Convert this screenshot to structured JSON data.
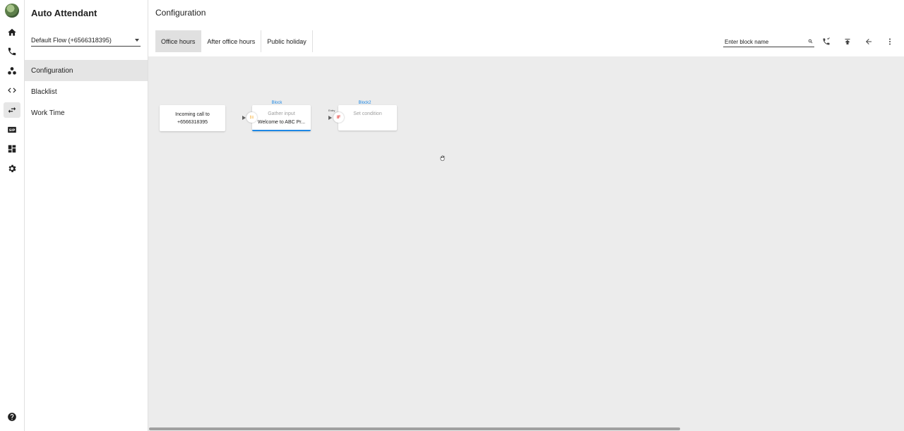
{
  "sidebar": {
    "title": "Auto Attendant",
    "flow": "Default Flow (+6566318395)",
    "items": [
      {
        "label": "Configuration"
      },
      {
        "label": "Blacklist"
      },
      {
        "label": "Work Time"
      }
    ]
  },
  "header": {
    "title": "Configuration"
  },
  "tabs": [
    {
      "label": "Office hours"
    },
    {
      "label": "After office hours"
    },
    {
      "label": "Public holiday"
    }
  ],
  "search": {
    "placeholder": "Enter block name"
  },
  "rail_icons": [
    "avatar",
    "home-icon",
    "phone-icon",
    "contacts-icon",
    "code-icon",
    "flow-icon",
    "sip-icon",
    "dashboard-icon",
    "settings-icon",
    "help-icon"
  ],
  "flow": {
    "start": {
      "line1": "Incoming call to",
      "line2": "+6566318395"
    },
    "block1": {
      "label": "Block",
      "type": "Gather input",
      "text": "Welcome to ABC Pr..."
    },
    "block2": {
      "label": "Block2",
      "type": "Set condition",
      "tiny": "Entry"
    }
  },
  "colors": {
    "accent": "#1e88e5",
    "canvas": "#ececec",
    "active": "#e0e0e0"
  }
}
